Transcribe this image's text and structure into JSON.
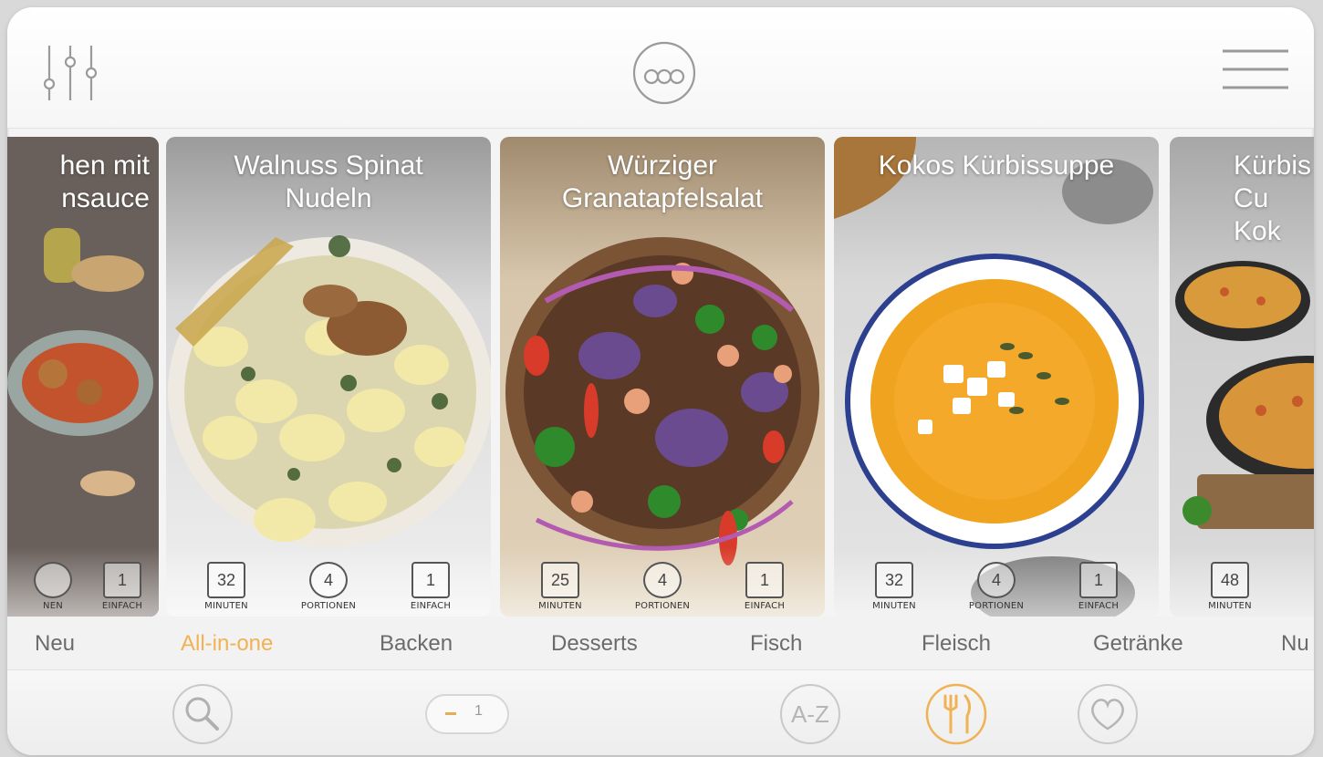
{
  "header": {
    "filter_icon": "sliders-icon",
    "logo_icon": "brand-logo",
    "menu_icon": "hamburger-menu-icon"
  },
  "recipes": [
    {
      "title": "hen mit\nnsauce",
      "stats": {
        "time": "",
        "portions": "",
        "difficulty": "1",
        "difficulty_label": "EINFACH",
        "portions_label": "NEN"
      }
    },
    {
      "title": "Walnuss Spinat\nNudeln",
      "stats": {
        "time": "32",
        "time_label": "MINUTEN",
        "portions": "4",
        "portions_label": "PORTIONEN",
        "difficulty": "1",
        "difficulty_label": "EINFACH"
      }
    },
    {
      "title": "Würziger\nGranatapfelsalat",
      "stats": {
        "time": "25",
        "time_label": "MINUTEN",
        "portions": "4",
        "portions_label": "PORTIONEN",
        "difficulty": "1",
        "difficulty_label": "EINFACH"
      }
    },
    {
      "title": "Kokos Kürbissuppe",
      "stats": {
        "time": "32",
        "time_label": "MINUTEN",
        "portions": "4",
        "portions_label": "PORTIONEN",
        "difficulty": "1",
        "difficulty_label": "EINFACH"
      }
    },
    {
      "title": "Kürbis\nCu\nKok",
      "stats": {
        "time": "48",
        "time_label": "MINUTEN"
      }
    }
  ],
  "categories": [
    "Neu",
    "All-in-one",
    "Backen",
    "Desserts",
    "Fisch",
    "Fleisch",
    "Getränke",
    "Nu"
  ],
  "active_category": "All-in-one",
  "bottom_nav": {
    "pager_value": "1",
    "az_label": "A-Z",
    "active_item": "recipes",
    "icons": [
      "search-icon",
      "pager",
      "a-z-icon",
      "cutlery-icon",
      "heart-icon"
    ]
  },
  "colors": {
    "accent": "#f0b254",
    "inactive_text": "#6b6b6b",
    "icon_stroke": "#9a9a9a"
  }
}
